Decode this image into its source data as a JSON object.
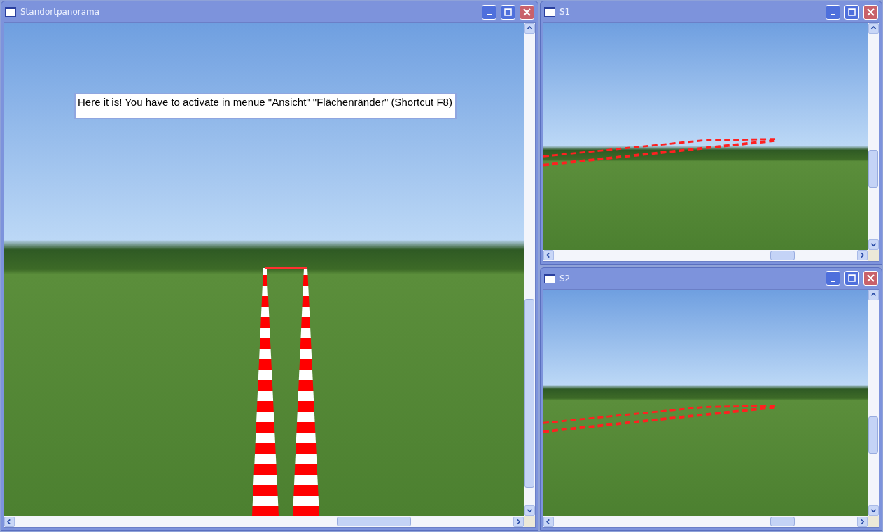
{
  "windows": [
    {
      "title": "Standortpanorama",
      "note": "Here it is! You have to activate in menue \"Ansicht\" \"Flächenränder\" (Shortcut F8)"
    },
    {
      "title": "S1"
    },
    {
      "title": "S2"
    }
  ]
}
